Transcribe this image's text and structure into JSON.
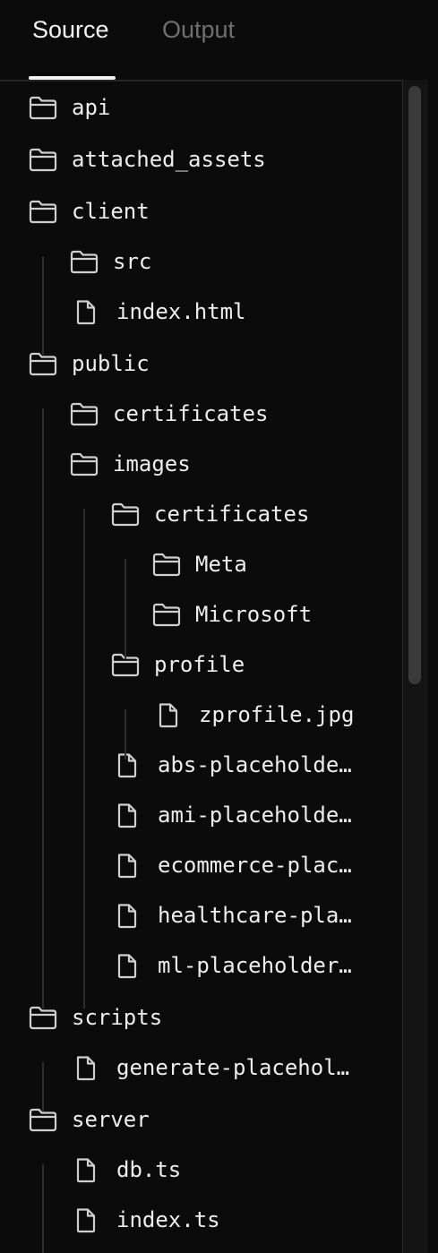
{
  "tabs": {
    "source": "Source",
    "output": "Output",
    "active": "Source"
  },
  "tree": [
    {
      "name": "api",
      "type": "folder",
      "depth": 0
    },
    {
      "name": "attached_assets",
      "type": "folder",
      "depth": 0
    },
    {
      "name": "client",
      "type": "folder",
      "depth": 0
    },
    {
      "name": "src",
      "type": "folder",
      "depth": 1
    },
    {
      "name": "index.html",
      "type": "file",
      "depth": 1
    },
    {
      "name": "public",
      "type": "folder",
      "depth": 0
    },
    {
      "name": "certificates",
      "type": "folder",
      "depth": 1
    },
    {
      "name": "images",
      "type": "folder",
      "depth": 1
    },
    {
      "name": "certificates",
      "type": "folder",
      "depth": 2
    },
    {
      "name": "Meta",
      "type": "folder",
      "depth": 3
    },
    {
      "name": "Microsoft",
      "type": "folder",
      "depth": 3
    },
    {
      "name": "profile",
      "type": "folder",
      "depth": 2
    },
    {
      "name": "zprofile.jpg",
      "type": "file",
      "depth": 3
    },
    {
      "name": "abs-placeholde…",
      "type": "file",
      "depth": 2
    },
    {
      "name": "ami-placeholde…",
      "type": "file",
      "depth": 2
    },
    {
      "name": "ecommerce-plac…",
      "type": "file",
      "depth": 2
    },
    {
      "name": "healthcare-pla…",
      "type": "file",
      "depth": 2
    },
    {
      "name": "ml-placeholder…",
      "type": "file",
      "depth": 2
    },
    {
      "name": "scripts",
      "type": "folder",
      "depth": 0
    },
    {
      "name": "generate-placehol…",
      "type": "file",
      "depth": 1
    },
    {
      "name": "server",
      "type": "folder",
      "depth": 0
    },
    {
      "name": "db.ts",
      "type": "file",
      "depth": 1
    },
    {
      "name": "index.ts",
      "type": "file",
      "depth": 1
    }
  ],
  "icons": {
    "folder": "folder-icon",
    "file": "file-icon"
  },
  "colors": {
    "background": "#0b0b0b",
    "text": "#ededed",
    "inactive_tab": "#6f6f6f",
    "guide": "#2e2e2e"
  }
}
